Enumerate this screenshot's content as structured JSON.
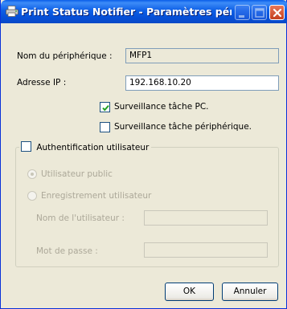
{
  "window": {
    "title": "Print Status Notifier - Paramètres péri..."
  },
  "device_name": {
    "label": "Nom du périphérique :",
    "value": "MFP1"
  },
  "ip_address": {
    "label": "Adresse IP :",
    "value": "192.168.10.20"
  },
  "pc_job_monitoring": {
    "label": "Surveillance tâche PC.",
    "checked": true
  },
  "device_job_monitoring": {
    "label": "Surveillance tâche périphérique.",
    "checked": false
  },
  "user_auth": {
    "label": "Authentification utilisateur",
    "checked": false,
    "public_user_label": "Utilisateur public",
    "registered_user_label": "Enregistrement utilisateur",
    "username_label": "Nom de l'utilisateur :",
    "password_label": "Mot de passe :",
    "username_value": "",
    "password_value": ""
  },
  "buttons": {
    "ok": "OK",
    "cancel": "Annuler"
  }
}
